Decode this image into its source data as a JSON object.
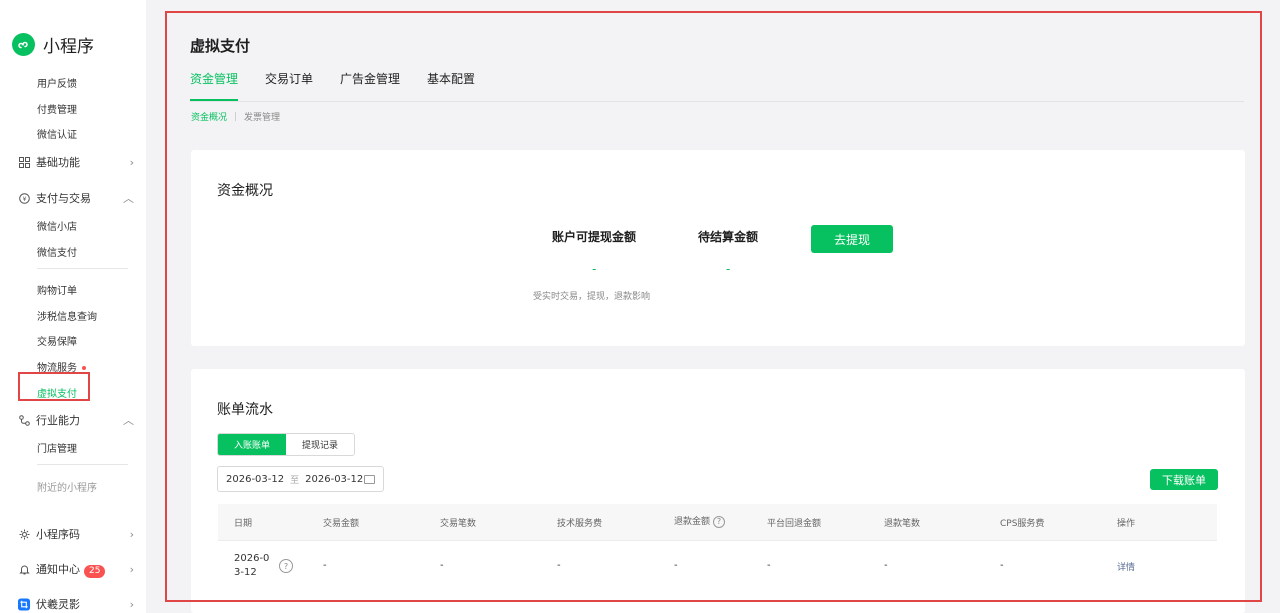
{
  "sidebar": {
    "brand": "小程序",
    "items": [
      {
        "label": "用户反馈"
      },
      {
        "label": "付费管理"
      },
      {
        "label": "微信认证"
      }
    ],
    "groups": {
      "basic": "基础功能",
      "pay": "支付与交易",
      "industry": "行业能力",
      "qrcode": "小程序码",
      "notify": "通知中心",
      "fuxi": "伏羲灵影"
    },
    "pay_items": [
      "微信小店",
      "微信支付",
      "购物订单",
      "涉税信息查询",
      "交易保障",
      "物流服务",
      "虚拟支付"
    ],
    "industry_items": [
      "门店管理"
    ],
    "recent": "附近的小程序",
    "notify_badge": "25"
  },
  "header": {
    "title": "虚拟支付",
    "tabs": [
      "资金管理",
      "交易订单",
      "广告金管理",
      "基本配置"
    ],
    "subtabs": [
      "资金概况",
      "发票管理"
    ]
  },
  "overview": {
    "title": "资金概况",
    "withdrawable_label": "账户可提现金额",
    "withdrawable_value": "-",
    "pending_label": "待结算金额",
    "pending_value": "-",
    "withdraw_button": "去提现",
    "note": "受实时交易，提现，退款影响"
  },
  "statement": {
    "title": "账单流水",
    "segments": [
      "入账账单",
      "提现记录"
    ],
    "date_start": "2026-03-12",
    "date_sep": "至",
    "date_end": "2026-03-12",
    "download_button": "下载账单",
    "columns": [
      "日期",
      "交易金额",
      "交易笔数",
      "技术服务费",
      "退款金额",
      "平台回退金额",
      "退款笔数",
      "CPS服务费",
      "操作"
    ],
    "rows": [
      {
        "date_line1": "2026-0",
        "date_line2": "3-12",
        "trade_amount": "-",
        "trade_count": "-",
        "service_fee": "-",
        "refund_amount": "-",
        "platform_refund": "-",
        "refund_count": "-",
        "cps_fee": "-",
        "action": "详情"
      }
    ]
  },
  "colors": {
    "accent": "#07c160",
    "highlight_border": "#e04646",
    "link": "#576b95",
    "badge": "#fa5151"
  }
}
